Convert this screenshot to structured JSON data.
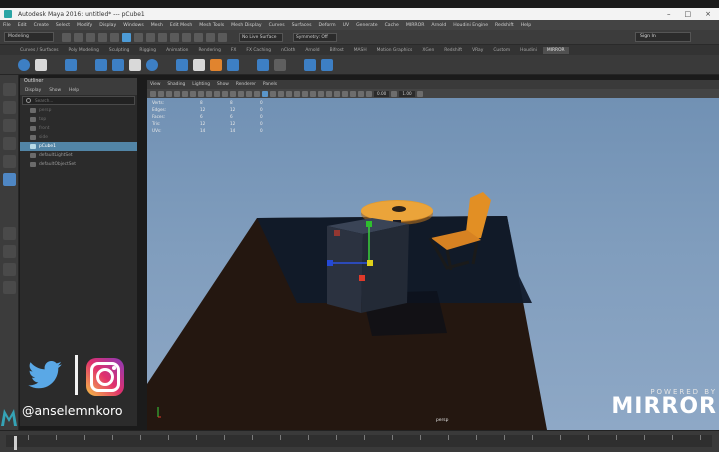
{
  "window": {
    "title": "Autodesk Maya 2016: untitled*   ---   pCube1",
    "controls": [
      "–",
      "□",
      "×"
    ]
  },
  "menubar": [
    "File",
    "Edit",
    "Create",
    "Select",
    "Modify",
    "Display",
    "Windows",
    "Mesh",
    "Edit Mesh",
    "Mesh Tools",
    "Mesh Display",
    "Curves",
    "Surfaces",
    "Deform",
    "UV",
    "Generate",
    "Cache",
    "MIRROR",
    "Arnold",
    "Houdini Engine",
    "Redshift",
    "Help"
  ],
  "statusline": {
    "mode": "Modeling",
    "live_surface": "No Live Surface",
    "symmetry": "Symmetry: Off",
    "sign_in": "Sign In"
  },
  "shelf_tabs": [
    "Curves / Surfaces",
    "Poly Modeling",
    "Sculpting",
    "Rigging",
    "Animation",
    "Rendering",
    "FX",
    "FX Caching",
    "nCloth",
    "Arnold",
    "Bifrost",
    "MASH",
    "Motion Graphics",
    "XGen",
    "Redshift",
    "VRay",
    "Custom",
    "Houdini",
    "MIRROR"
  ],
  "shelf_active": "MIRROR",
  "outliner": {
    "title": "Outliner",
    "menu": [
      "Display",
      "Show",
      "Help"
    ],
    "search_placeholder": "Search...",
    "items": [
      {
        "label": "persp",
        "selected": false,
        "dim": true
      },
      {
        "label": "top",
        "selected": false,
        "dim": true
      },
      {
        "label": "front",
        "selected": false,
        "dim": true
      },
      {
        "label": "side",
        "selected": false,
        "dim": true
      },
      {
        "label": "pCube1",
        "selected": true,
        "dim": false
      },
      {
        "label": "defaultLightSet",
        "selected": false,
        "dim": false
      },
      {
        "label": "defaultObjectSet",
        "selected": false,
        "dim": false
      }
    ]
  },
  "viewport": {
    "menu": [
      "View",
      "Shading",
      "Lighting",
      "Show",
      "Renderer",
      "Panels"
    ],
    "field_1": "0.00",
    "field_2": "1.00",
    "camera": "persp",
    "hud": [
      {
        "label": "Verts:",
        "a": "8",
        "b": "8",
        "c": "0"
      },
      {
        "label": "Edges:",
        "a": "12",
        "b": "12",
        "c": "0"
      },
      {
        "label": "Faces:",
        "a": "6",
        "b": "6",
        "c": "0"
      },
      {
        "label": "Tris:",
        "a": "12",
        "b": "12",
        "c": "0"
      },
      {
        "label": "UVs:",
        "a": "14",
        "b": "14",
        "c": "0"
      }
    ]
  },
  "overlay": {
    "handle": "@anselemnkoro",
    "watermark_sub": "POWERED BY",
    "watermark_main": "MIRROR"
  },
  "colors": {
    "accent": "#4f87c4",
    "selection": "#5285a6",
    "viewport_sky": "#809dbd",
    "floor": "#2b1c14",
    "chair": "#e5952b"
  }
}
